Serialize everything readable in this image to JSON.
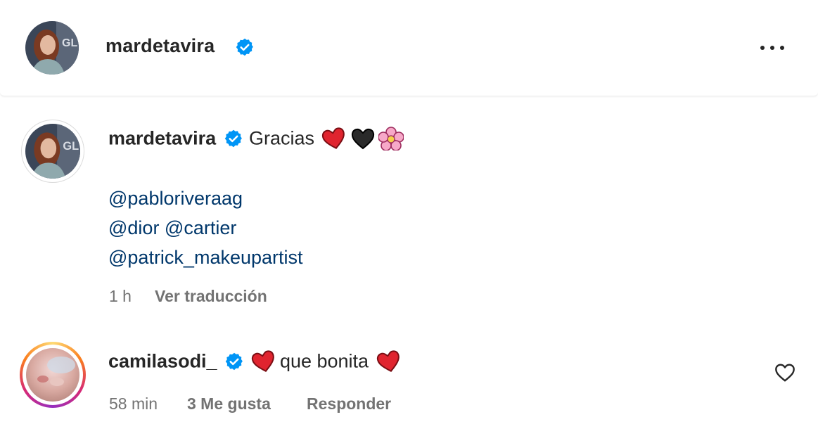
{
  "header": {
    "username": "mardetavira",
    "icons": {
      "verified": "verified-badge-icon",
      "more": "more-options-icon"
    }
  },
  "caption": {
    "username": "mardetavira",
    "text": "Gracias",
    "emojis": [
      "red-heart-emoji",
      "black-heart-emoji",
      "cherry-blossom-emoji"
    ],
    "mentions": [
      "@pabloriveraag",
      "@dior @cartier",
      "@patrick_makeupartist"
    ],
    "time": "1 h",
    "translate_label": "Ver traducción"
  },
  "comment": {
    "username": "camilasodi_",
    "text": "que bonita",
    "emojis": [
      "red-heart-emoji",
      "red-heart-emoji"
    ],
    "time": "58 min",
    "likes": "3 Me gusta",
    "reply_label": "Responder",
    "like_icon": "heart-outline-icon"
  },
  "colors": {
    "text": "#262626",
    "secondary": "#737373",
    "mention": "#00376b",
    "verified": "#0095f6"
  }
}
